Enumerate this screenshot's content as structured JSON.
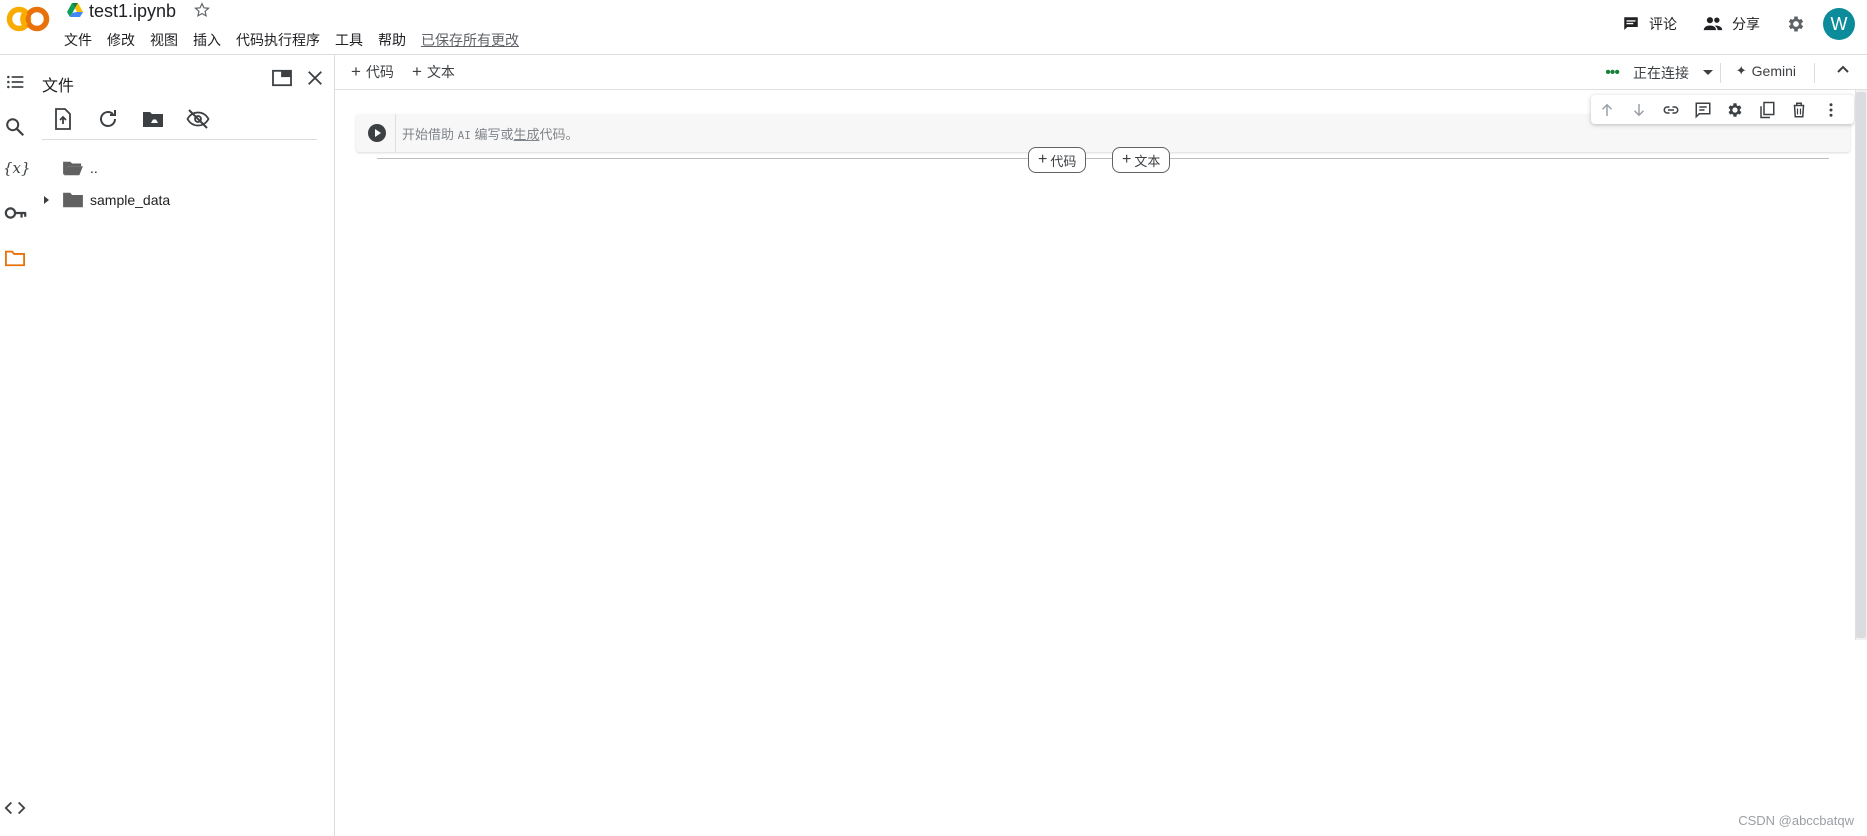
{
  "header": {
    "title": "test1.ipynb",
    "menu": [
      "文件",
      "修改",
      "视图",
      "插入",
      "代码执行程序",
      "工具",
      "帮助"
    ],
    "saved_status": "已保存所有更改",
    "comment_label": "评论",
    "share_label": "分享",
    "avatar_letter": "W"
  },
  "sidebar": {
    "title": "文件",
    "files": [
      {
        "name": "..",
        "type": "parent-folder"
      },
      {
        "name": "sample_data",
        "type": "folder"
      }
    ]
  },
  "toolbar": {
    "add_code": "代码",
    "add_text": "文本",
    "connection_status": "正在连接",
    "gemini_label": "Gemini"
  },
  "cell": {
    "placeholder_a": "开始借助 ",
    "placeholder_ai": "AI",
    "placeholder_b": " 编写或",
    "placeholder_generate": "生成",
    "placeholder_c": "代码。"
  },
  "insert": {
    "code": "代码",
    "text": "文本"
  },
  "watermark": "CSDN @abccbatqw",
  "colors": {
    "logo_orange": "#F9AB00",
    "logo_dark_orange": "#E8710A",
    "avatar_bg": "#0C8B9B",
    "connecting_green": "#188038",
    "active_rail_icon": "#E8710A"
  }
}
